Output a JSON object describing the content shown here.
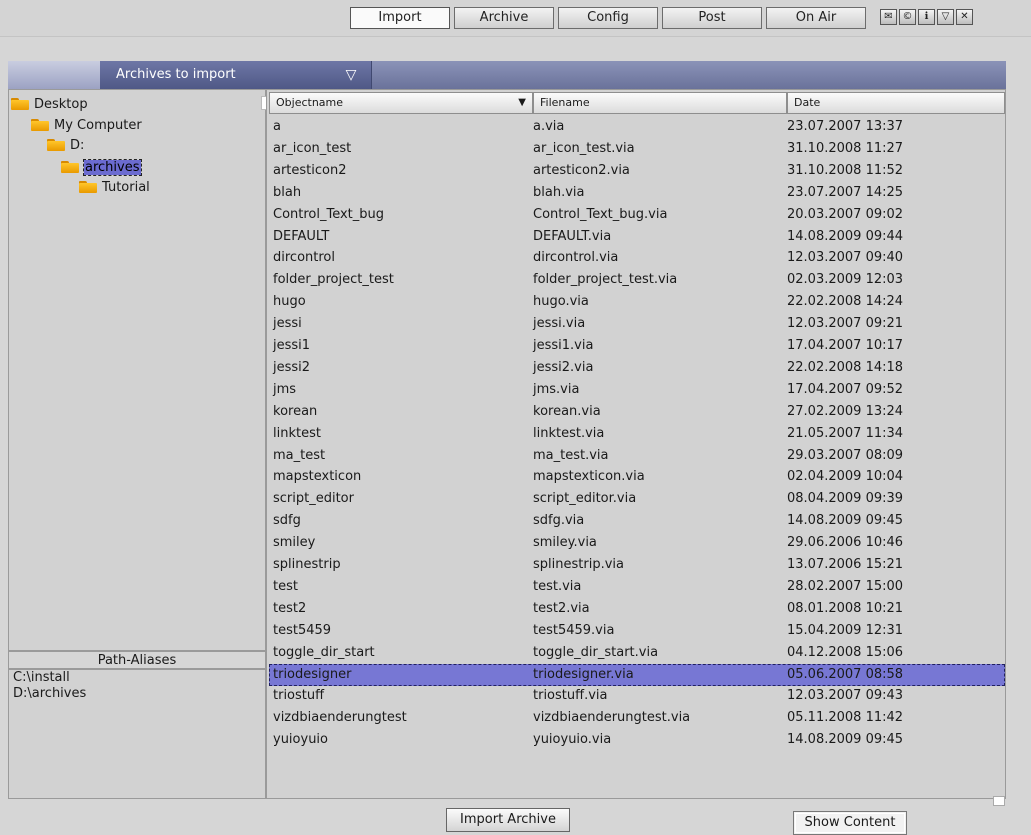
{
  "tabs": [
    "Import",
    "Archive",
    "Config",
    "Post",
    "On Air"
  ],
  "active_tab": "Import",
  "top_icons": [
    "envelope-icon",
    "c-icon",
    "info-icon",
    "minimize-icon",
    "close-icon"
  ],
  "archive_dropdown": {
    "label": "Archives to import"
  },
  "tree": {
    "items": [
      "Desktop",
      "My Computer",
      "D:",
      "archives",
      "Tutorial"
    ],
    "selected": "archives"
  },
  "path_aliases": {
    "header": "Path-Aliases",
    "items": [
      "C:\\install",
      "D:\\archives"
    ]
  },
  "table": {
    "headers": [
      "Objectname",
      "Filename",
      "Date"
    ],
    "rows": [
      [
        "a",
        "a.via",
        "23.07.2007 13:37"
      ],
      [
        "ar_icon_test",
        "ar_icon_test.via",
        "31.10.2008 11:27"
      ],
      [
        "artesticon2",
        "artesticon2.via",
        "31.10.2008 11:52"
      ],
      [
        "blah",
        "blah.via",
        "23.07.2007 14:25"
      ],
      [
        "Control_Text_bug",
        "Control_Text_bug.via",
        "20.03.2007 09:02"
      ],
      [
        "DEFAULT",
        "DEFAULT.via",
        "14.08.2009 09:44"
      ],
      [
        "dircontrol",
        "dircontrol.via",
        "12.03.2007 09:40"
      ],
      [
        "folder_project_test",
        "folder_project_test.via",
        "02.03.2009 12:03"
      ],
      [
        "hugo",
        "hugo.via",
        "22.02.2008 14:24"
      ],
      [
        "jessi",
        "jessi.via",
        "12.03.2007 09:21"
      ],
      [
        "jessi1",
        "jessi1.via",
        "17.04.2007 10:17"
      ],
      [
        "jessi2",
        "jessi2.via",
        "22.02.2008 14:18"
      ],
      [
        "jms",
        "jms.via",
        "17.04.2007 09:52"
      ],
      [
        "korean",
        "korean.via",
        "27.02.2009 13:24"
      ],
      [
        "linktest",
        "linktest.via",
        "21.05.2007 11:34"
      ],
      [
        "ma_test",
        "ma_test.via",
        "29.03.2007 08:09"
      ],
      [
        "mapstexticon",
        "mapstexticon.via",
        "02.04.2009 10:04"
      ],
      [
        "script_editor",
        "script_editor.via",
        "08.04.2009 09:39"
      ],
      [
        "sdfg",
        "sdfg.via",
        "14.08.2009 09:45"
      ],
      [
        "smiley",
        "smiley.via",
        "29.06.2006 10:46"
      ],
      [
        "splinestrip",
        "splinestrip.via",
        "13.07.2006 15:21"
      ],
      [
        "test",
        "test.via",
        "28.02.2007 15:00"
      ],
      [
        "test2",
        "test2.via",
        "08.01.2008 10:21"
      ],
      [
        "test5459",
        "test5459.via",
        "15.04.2009 12:31"
      ],
      [
        "toggle_dir_start",
        "toggle_dir_start.via",
        "04.12.2008 15:06"
      ],
      [
        "triodesigner",
        "triodesigner.via",
        "05.06.2007 08:58"
      ],
      [
        "triostuff",
        "triostuff.via",
        "12.03.2007 09:43"
      ],
      [
        "vizdbiaenderungtest",
        "vizdbiaenderungtest.via",
        "05.11.2008 11:42"
      ],
      [
        "yuioyuio",
        "yuioyuio.via",
        "14.08.2009 09:45"
      ]
    ],
    "selected_row": "triodesigner"
  },
  "buttons": {
    "import_archive": "Import Archive",
    "show_content": "Show Content"
  }
}
